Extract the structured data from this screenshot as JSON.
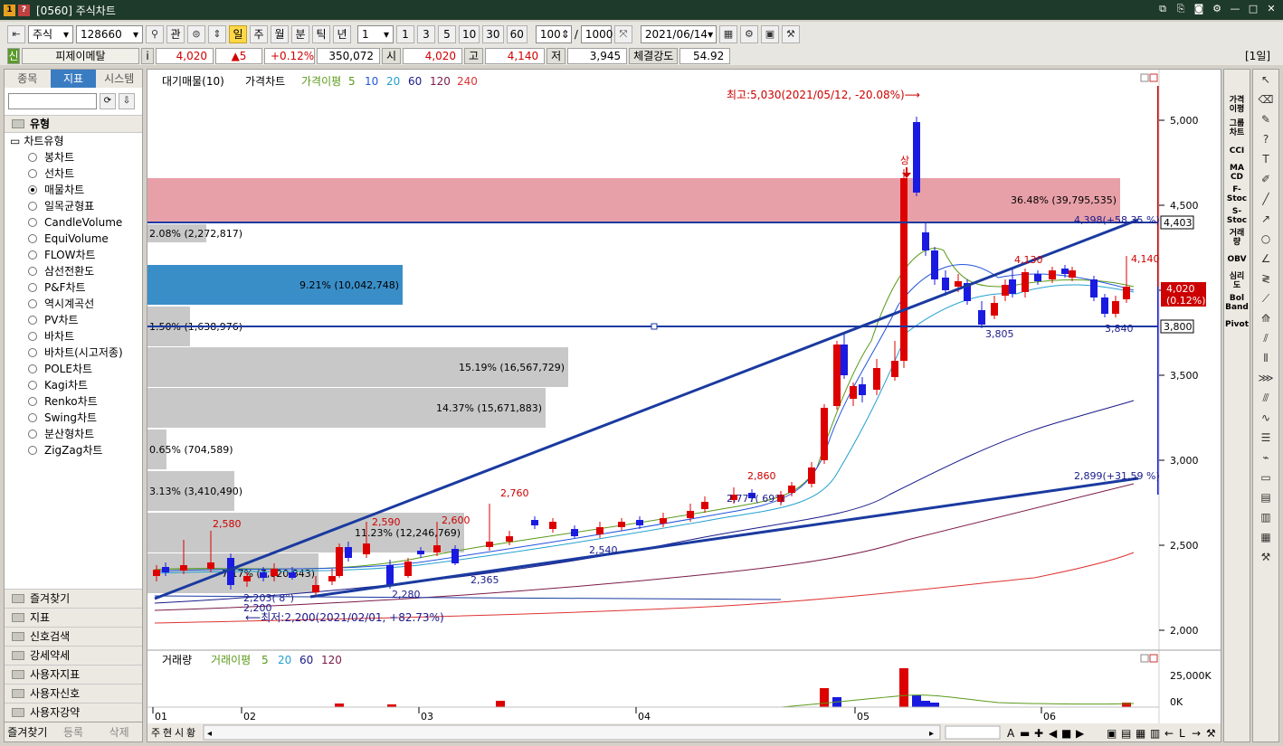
{
  "window": {
    "title": "[0560] 주식차트",
    "icon1": "1",
    "icon2": "?"
  },
  "toolbar": {
    "market": "주식",
    "code": "128660",
    "gwan": "관",
    "periods": [
      "일",
      "주",
      "월",
      "분",
      "틱",
      "년"
    ],
    "active_period": "일",
    "interval": "1",
    "quick": [
      "1",
      "3",
      "5",
      "10",
      "30",
      "60"
    ],
    "count": "100",
    "total": "1000",
    "date": "2021/06/14"
  },
  "info": {
    "tag": "신",
    "name": "피제이메탈",
    "i": "i",
    "price": "4,020",
    "change": "▲5",
    "rate": "+0.12%",
    "volume": "350,072",
    "open_label": "시",
    "open": "4,020",
    "high_label": "고",
    "high": "4,140",
    "low_label": "저",
    "low": "3,945",
    "strength_label": "체결강도",
    "strength": "54.92",
    "day": "[1일]"
  },
  "left": {
    "tabs": [
      "종목",
      "지표",
      "시스템"
    ],
    "active_tab": "지표",
    "section": "유형",
    "group": "차트유형",
    "items": [
      "봉차트",
      "선차트",
      "매물차트",
      "일목균형표",
      "CandleVolume",
      "EquiVolume",
      "FLOW차트",
      "삼선전환도",
      "P&F차트",
      "역시계곡선",
      "PV차트",
      "바차트",
      "바차트(시고저종)",
      "POLE차트",
      "Kagi차트",
      "Renko차트",
      "Swing차트",
      "분산형차트",
      "ZigZag차트"
    ],
    "selected": "매물차트",
    "bottom": [
      "즐겨찾기",
      "지표",
      "신호검색",
      "강세약세",
      "사용자지표",
      "사용자신호",
      "사용자강약"
    ],
    "btabs": [
      "즐겨찾기",
      "등록",
      "삭제"
    ]
  },
  "chart": {
    "legend": {
      "vp": "대기매물(10)",
      "price": "가격차트",
      "ma": "가격이평",
      "ma5": "5",
      "ma10": "10",
      "ma20": "20",
      "ma60": "60",
      "ma120": "120",
      "ma240": "240"
    },
    "colors": {
      "ma5": "#5a9a1a",
      "ma10": "#2255dd",
      "ma20": "#22a0d0",
      "ma60": "#1a1a8a",
      "ma120": "#7a1a4a",
      "ma240": "#dd3333",
      "up": "#dd0000",
      "down": "#1a1ae0"
    },
    "y_ticks": [
      "5,000",
      "4,500",
      "4,000",
      "3,500",
      "3,000",
      "2,500",
      "2,000"
    ],
    "x_ticks": [
      "01",
      "02",
      "03",
      "04",
      "05",
      "06"
    ],
    "high_note": "최고:5,030(2021/05/12, -20.08%)⟶",
    "low_note": "⟵최저:2,200(2021/02/01, +82.73%)",
    "vp_labels": [
      "36.48% (39,795,535)",
      "2.08% (2,272,817)",
      "9.21% (10,042,748)",
      "1.50% (1,638,976)",
      "15.19% (16,567,729)",
      "14.37% (15,671,883)",
      "0.65% (704,589)",
      "3.13% (3,410,490)",
      "11.23% (12,246,769)",
      "7.17% (7,820,843)"
    ],
    "annot": {
      "a2580": "2,580",
      "a2590": "2,590",
      "a2600": "2,600",
      "a2760": "2,760",
      "a2860": "2,860",
      "a4130": "4,130",
      "a4140": "4,140",
      "a2540": "2,540",
      "a2365": "2,365",
      "a2280": "2,280",
      "a2203": "2,203(  8°)",
      "a2200": "2,200",
      "a2777": "2,777(  69°)",
      "a3805": "3,805",
      "a3840": "3,840",
      "trend1": "4,398(+58.35 %)",
      "trend2": "2,899(+31.59 %)",
      "sang": "상"
    },
    "price_tag": "4,020",
    "price_tag2": "(0.12%)",
    "line_tag1": "4,403",
    "line_tag2": "3,800",
    "vol_legend": {
      "v": "거래량",
      "vma": "거래이평",
      "v5": "5",
      "v20": "20",
      "v60": "60",
      "v120": "120"
    },
    "vol_ticks": [
      "25,000K",
      "0K"
    ],
    "bottom_tabs": [
      "주",
      "현",
      "시",
      "황"
    ]
  },
  "rightbar": [
    "가격\n이평",
    "그룹\n차트",
    "CCI",
    "MA\nCD",
    "F-\nStoc",
    "S-\nStoc",
    "거래\n량",
    "OBV",
    "심리\n도",
    "Bol\nBand",
    "Pivot"
  ]
}
